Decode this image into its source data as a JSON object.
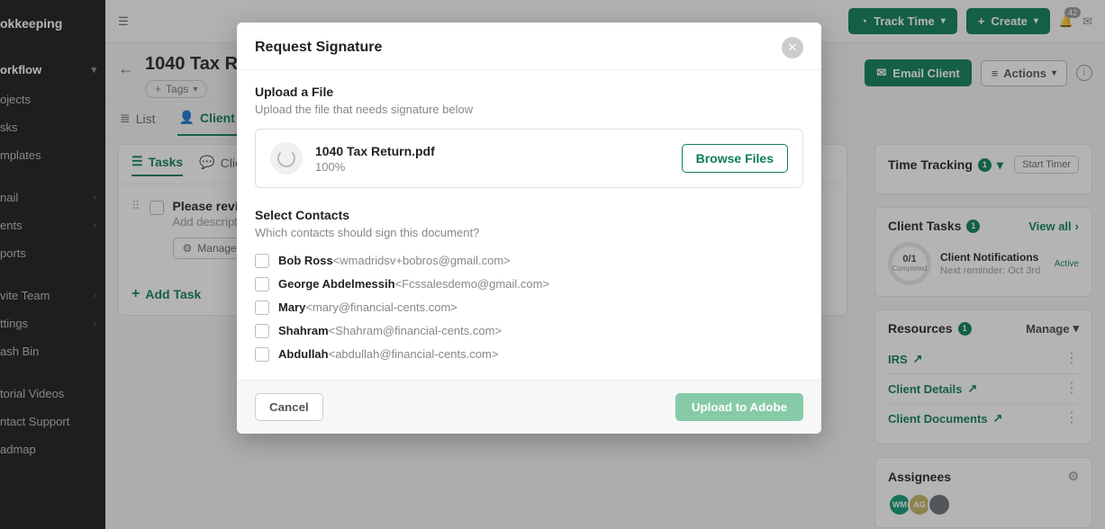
{
  "sidebar": {
    "brand": "okkeeping",
    "workflow": "orkflow",
    "items": [
      {
        "label": "ojects",
        "chev": false
      },
      {
        "label": "sks",
        "chev": false
      },
      {
        "label": "mplates",
        "chev": false
      },
      {
        "label": "nail",
        "chev": true
      },
      {
        "label": "ents",
        "chev": true
      },
      {
        "label": "ports",
        "chev": false
      },
      {
        "label": "vite Team",
        "chev": true
      },
      {
        "label": "ttings",
        "chev": true
      },
      {
        "label": "ash Bin",
        "chev": false
      },
      {
        "label": "torial Videos",
        "chev": false
      },
      {
        "label": "ntact Support",
        "chev": false
      },
      {
        "label": "admap",
        "chev": false
      }
    ]
  },
  "topbar": {
    "track_time": "Track Time",
    "create": "Create",
    "notif_count": "42"
  },
  "header": {
    "title": "1040 Tax Return",
    "tags": "Tags",
    "email_client": "Email Client",
    "actions": "Actions"
  },
  "tabs": {
    "list": "List",
    "client_tasks": "Client Ta"
  },
  "inner_tabs": {
    "tasks": "Tasks",
    "clien": "Clien"
  },
  "task": {
    "title": "Please review",
    "desc": "Add descriptio",
    "manage": "Manage Clie"
  },
  "add_task": "Add Task",
  "time_tracking": {
    "title": "Time Tracking",
    "badge": "1",
    "start": "Start Timer"
  },
  "client_tasks_panel": {
    "title": "Client Tasks",
    "badge": "1",
    "view_all": "View all",
    "count": "0/1",
    "completed": "Completed",
    "notif_title": "Client Notifications",
    "next_reminder": "Next reminder: Oct 3rd",
    "active": "Active"
  },
  "resources": {
    "title": "Resources",
    "badge": "1",
    "manage": "Manage",
    "items": [
      {
        "label": "IRS"
      },
      {
        "label": "Client Details"
      },
      {
        "label": "Client Documents"
      }
    ]
  },
  "assignees": {
    "title": "Assignees",
    "avatars": [
      "WM",
      "AG",
      ""
    ]
  },
  "modal": {
    "title": "Request Signature",
    "upload_head": "Upload a File",
    "upload_sub": "Upload the file that needs signature below",
    "file_name": "1040 Tax Return.pdf",
    "file_progress": "100%",
    "browse": "Browse Files",
    "contacts_head": "Select Contacts",
    "contacts_sub": "Which contacts should sign this document?",
    "contacts": [
      {
        "name": "Bob Ross",
        "email": "<wmadridsv+bobros@gmail.com>"
      },
      {
        "name": "George Abdelmessih",
        "email": "<Fcssalesdemo@gmail.com>"
      },
      {
        "name": "Mary",
        "email": "<mary@financial-cents.com>"
      },
      {
        "name": "Shahram",
        "email": "<Shahram@financial-cents.com>"
      },
      {
        "name": "Abdullah",
        "email": "<abdullah@financial-cents.com>"
      }
    ],
    "cancel": "Cancel",
    "upload": "Upload to Adobe"
  }
}
